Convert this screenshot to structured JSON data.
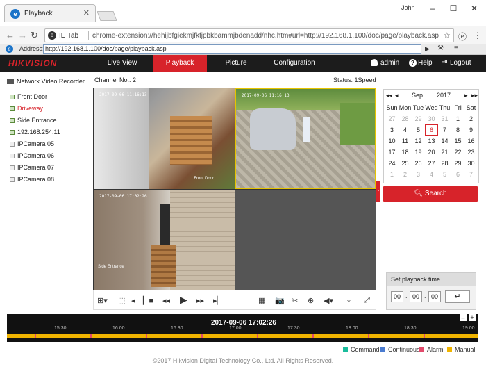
{
  "browser": {
    "tab_title": "Playback",
    "tab_close": "✕",
    "user": "John",
    "window_controls": [
      "–",
      "☐",
      "✕"
    ],
    "ietab_label": "IE Tab",
    "url": "chrome-extension://hehijbfgiekmjfkfjpbkbammjbdenadd/nhc.htm#url=http://192.168.1.100/doc/page/playback.asp",
    "address_label": "Address:",
    "address_value": "http://192.168.1.100/doc/page/playback.asp",
    "accent": "#1a73c8"
  },
  "header": {
    "logo": "HIKVISION",
    "menu": [
      {
        "label": "Live View"
      },
      {
        "label": "Playback"
      },
      {
        "label": "Picture"
      },
      {
        "label": "Configuration"
      }
    ],
    "active_menu": "Playback",
    "user": "admin",
    "help": "Help",
    "logout": "Logout",
    "brand_color": "#d7232a"
  },
  "sidebar": {
    "title": "Network Video Recorder",
    "items": [
      {
        "label": "Front Door",
        "active": false
      },
      {
        "label": "Driveway",
        "active": true
      },
      {
        "label": "Side Entrance",
        "active": false
      },
      {
        "label": "192.168.254.11",
        "active": false
      },
      {
        "label": "IPCamera 05",
        "active": false
      },
      {
        "label": "IPCamera 06",
        "active": false
      },
      {
        "label": "IPCamera 07",
        "active": false
      },
      {
        "label": "IPCamera 08",
        "active": false
      }
    ]
  },
  "main": {
    "channel_label": "Channel No.: 2",
    "status_label": "Status: 1Speed",
    "tiles": [
      {
        "stamp": "2017-09-06 11:16:13",
        "camera": "Front Door"
      },
      {
        "stamp": "2017-09-06 11:16:13",
        "camera": ""
      },
      {
        "stamp": "2017-09-06 17:02:26",
        "camera": "Side Entrance"
      }
    ]
  },
  "calendar": {
    "month": "Sep",
    "year": "2017",
    "weekdays": [
      "Sun",
      "Mon",
      "Tue",
      "Wed",
      "Thu",
      "Fri",
      "Sat"
    ],
    "weeks": [
      [
        "27",
        "28",
        "29",
        "30",
        "31",
        "1",
        "2"
      ],
      [
        "3",
        "4",
        "5",
        "6",
        "7",
        "8",
        "9"
      ],
      [
        "10",
        "11",
        "12",
        "13",
        "14",
        "15",
        "16"
      ],
      [
        "17",
        "18",
        "19",
        "20",
        "21",
        "22",
        "23"
      ],
      [
        "24",
        "25",
        "26",
        "27",
        "28",
        "29",
        "30"
      ],
      [
        "1",
        "2",
        "3",
        "4",
        "5",
        "6",
        "7"
      ]
    ],
    "selected_day": "6",
    "search_label": "Search"
  },
  "playback_time": {
    "title": "Set playback time",
    "hh": "00",
    "mm": "00",
    "ss": "00"
  },
  "timeline": {
    "current": "2017-09-06 17:02:26",
    "ticks": [
      "15:30",
      "16:00",
      "16:30",
      "17:00",
      "17:30",
      "18:00",
      "18:30",
      "19:00"
    ]
  },
  "legend": [
    {
      "label": "Command",
      "color": "#1abc9c"
    },
    {
      "label": "Continuous",
      "color": "#4a7bd0"
    },
    {
      "label": "Alarm",
      "color": "#e24a6b"
    },
    {
      "label": "Manual",
      "color": "#f0b400"
    }
  ],
  "footer": "©2017 Hikvision Digital Technology Co., Ltd. All Rights Reserved."
}
